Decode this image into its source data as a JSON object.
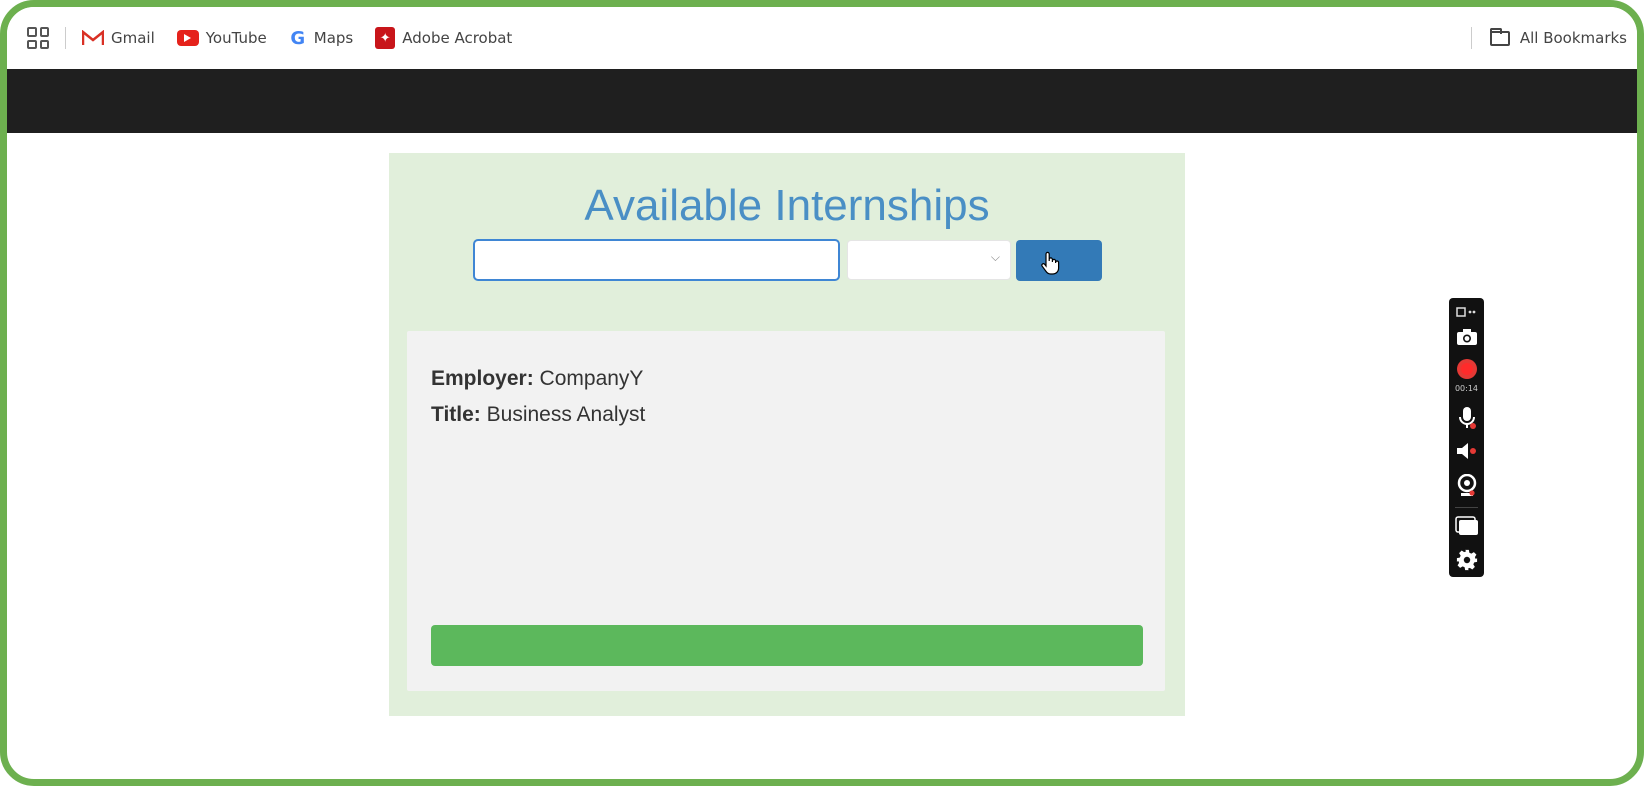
{
  "bookmarks_bar": {
    "items": [
      {
        "label": "Gmail",
        "icon": "gmail-icon"
      },
      {
        "label": "YouTube",
        "icon": "youtube-icon"
      },
      {
        "label": "Maps",
        "icon": "google-maps-icon"
      },
      {
        "label": "Adobe Acrobat",
        "icon": "adobe-acrobat-icon"
      }
    ],
    "all_bookmarks_label": "All Bookmarks"
  },
  "page": {
    "title": "Available Internships",
    "search": {
      "value": "",
      "placeholder": ""
    },
    "filter": {
      "selected": ""
    },
    "search_button_label": "",
    "listing": {
      "employer_label": "Employer:",
      "employer_value": "CompanyY",
      "title_label": "Title:",
      "title_value": "Business Analyst",
      "apply_button_label": ""
    }
  },
  "recording_toolbar": {
    "timer": "00:14",
    "tools": [
      "drag-handle-icon",
      "camera-icon",
      "record-icon",
      "microphone-icon",
      "speaker-icon",
      "webcam-icon",
      "window-icon",
      "gear-icon"
    ]
  },
  "colors": {
    "frame_border": "#6db04f",
    "header": "#1f1f1f",
    "panel_background": "#e1efdb",
    "title": "#4a8fc5",
    "search_button": "#337ab7",
    "apply_button": "#5cb85c",
    "record": "#e53935"
  }
}
